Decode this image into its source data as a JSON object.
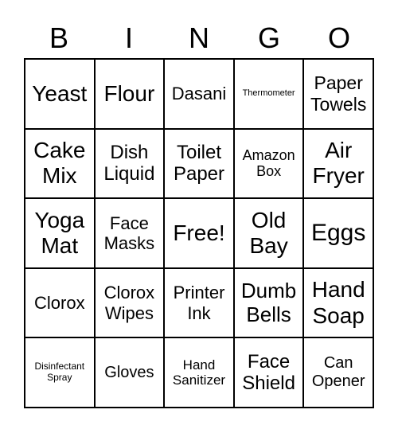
{
  "header": [
    "B",
    "I",
    "N",
    "G",
    "O"
  ],
  "cells": [
    {
      "text": "Yeast",
      "size": 28
    },
    {
      "text": "Flour",
      "size": 28
    },
    {
      "text": "Dasani",
      "size": 22
    },
    {
      "text": "Thermometer",
      "size": 11
    },
    {
      "text": "Paper Towels",
      "size": 23
    },
    {
      "text": "Cake Mix",
      "size": 28
    },
    {
      "text": "Dish Liquid",
      "size": 24
    },
    {
      "text": "Toilet Paper",
      "size": 24
    },
    {
      "text": "Amazon Box",
      "size": 18
    },
    {
      "text": "Air Fryer",
      "size": 28
    },
    {
      "text": "Yoga Mat",
      "size": 28
    },
    {
      "text": "Face Masks",
      "size": 22
    },
    {
      "text": "Free!",
      "size": 28
    },
    {
      "text": "Old Bay",
      "size": 28
    },
    {
      "text": "Eggs",
      "size": 30
    },
    {
      "text": "Clorox",
      "size": 22
    },
    {
      "text": "Clorox Wipes",
      "size": 22
    },
    {
      "text": "Printer Ink",
      "size": 22
    },
    {
      "text": "Dumb Bells",
      "size": 26
    },
    {
      "text": "Hand Soap",
      "size": 28
    },
    {
      "text": "Disinfectant Spray",
      "size": 12
    },
    {
      "text": "Gloves",
      "size": 20
    },
    {
      "text": "Hand Sanitizer",
      "size": 17
    },
    {
      "text": "Face Shield",
      "size": 24
    },
    {
      "text": "Can Opener",
      "size": 20
    }
  ]
}
